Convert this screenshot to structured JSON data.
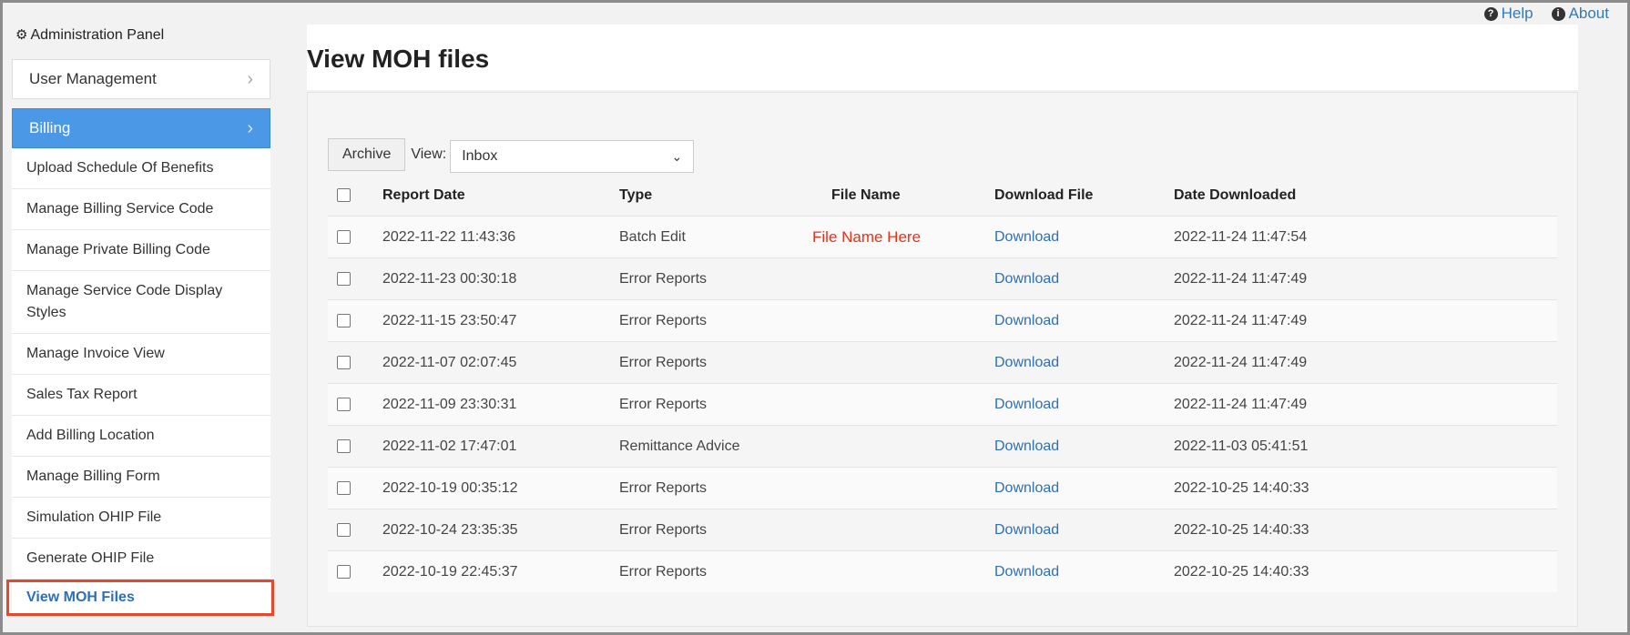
{
  "topbar": {
    "help": "Help",
    "about": "About"
  },
  "sidebar": {
    "panel_title": "Administration Panel",
    "user_management": "User Management",
    "billing": "Billing",
    "items": [
      "Upload Schedule Of Benefits",
      "Manage Billing Service Code",
      "Manage Private Billing Code",
      "Manage Service Code Display Styles",
      "Manage Invoice View",
      "Sales Tax Report",
      "Add Billing Location",
      "Manage Billing Form",
      "Simulation OHIP File",
      "Generate OHIP File",
      "View MOH Files"
    ]
  },
  "main": {
    "title": "View MOH files",
    "archive_label": "Archive",
    "view_label": "View:",
    "view_selected": "Inbox",
    "columns": [
      "Report Date",
      "Type",
      "File Name",
      "Download File",
      "Date Downloaded"
    ],
    "rows": [
      {
        "date": "2022-11-22 11:43:36",
        "type": "Batch Edit",
        "file": "File Name Here",
        "download": "Download",
        "downloaded": "2022-11-24 11:47:54"
      },
      {
        "date": "2022-11-23 00:30:18",
        "type": "Error Reports",
        "file": "",
        "download": "Download",
        "downloaded": "2022-11-24 11:47:49"
      },
      {
        "date": "2022-11-15 23:50:47",
        "type": "Error Reports",
        "file": "",
        "download": "Download",
        "downloaded": "2022-11-24 11:47:49"
      },
      {
        "date": "2022-11-07 02:07:45",
        "type": "Error Reports",
        "file": "",
        "download": "Download",
        "downloaded": "2022-11-24 11:47:49"
      },
      {
        "date": "2022-11-09 23:30:31",
        "type": "Error Reports",
        "file": "",
        "download": "Download",
        "downloaded": "2022-11-24 11:47:49"
      },
      {
        "date": "2022-11-02 17:47:01",
        "type": "Remittance Advice",
        "file": "",
        "download": "Download",
        "downloaded": "2022-11-03 05:41:51"
      },
      {
        "date": "2022-10-19 00:35:12",
        "type": "Error Reports",
        "file": "",
        "download": "Download",
        "downloaded": "2022-10-25 14:40:33"
      },
      {
        "date": "2022-10-24 23:35:35",
        "type": "Error Reports",
        "file": "",
        "download": "Download",
        "downloaded": "2022-10-25 14:40:33"
      },
      {
        "date": "2022-10-19 22:45:37",
        "type": "Error Reports",
        "file": "",
        "download": "Download",
        "downloaded": "2022-10-25 14:40:33"
      }
    ]
  }
}
